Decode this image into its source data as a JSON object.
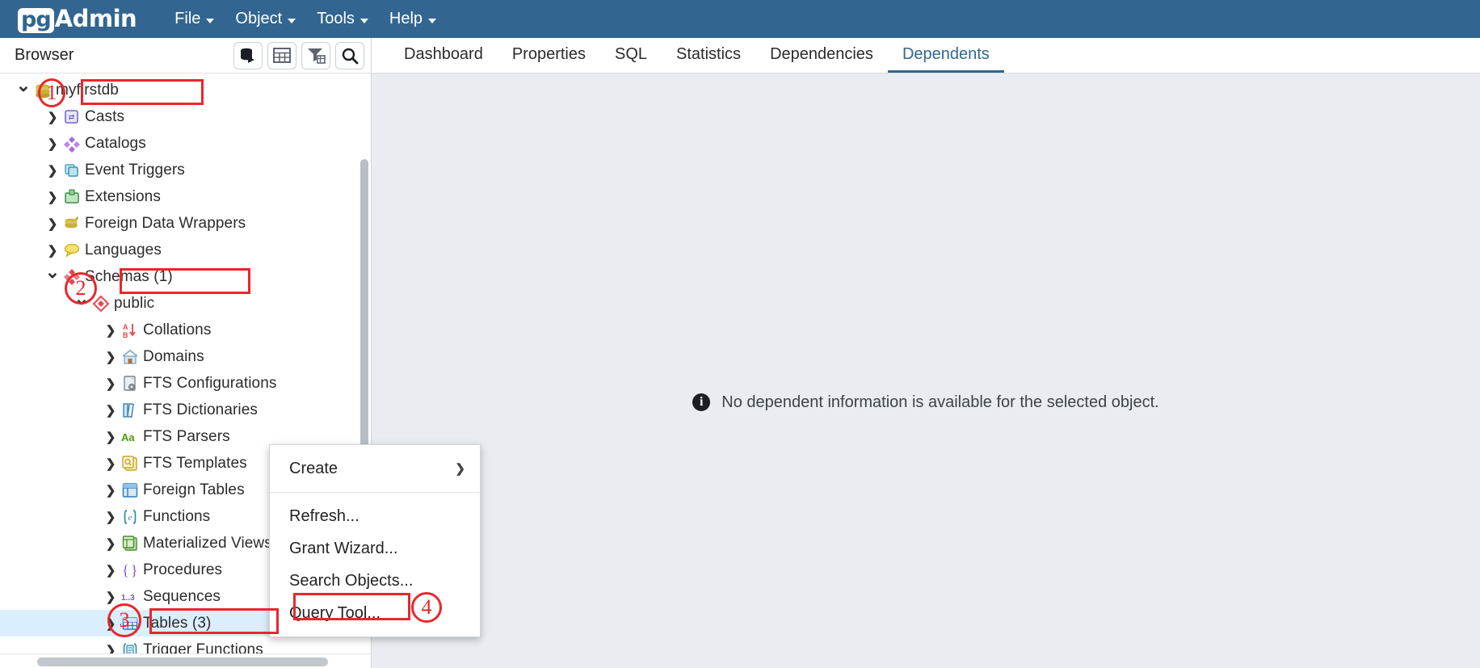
{
  "app": {
    "logo_pg": "pg",
    "logo_admin": "Admin",
    "menus": [
      {
        "label": "File",
        "icon": "chevron-down-icon"
      },
      {
        "label": "Object",
        "icon": "chevron-down-icon"
      },
      {
        "label": "Tools",
        "icon": "chevron-down-icon"
      },
      {
        "label": "Help",
        "icon": "chevron-down-icon"
      }
    ]
  },
  "browser": {
    "title": "Browser",
    "tools": [
      {
        "name": "object-explorer-icon",
        "title": "Object Explorer"
      },
      {
        "name": "grid-view-icon",
        "title": "Grid"
      },
      {
        "name": "filter-icon",
        "title": "Filter"
      },
      {
        "name": "search-icon",
        "title": "Search"
      }
    ],
    "tree": [
      {
        "label": "myfirstdb",
        "icon": "database-icon",
        "indent": 0,
        "state": "open",
        "selected": false,
        "boxed": true
      },
      {
        "label": "Casts",
        "icon": "casts-icon",
        "indent": 1,
        "state": "closed",
        "selected": false,
        "boxed": false
      },
      {
        "label": "Catalogs",
        "icon": "catalogs-icon",
        "indent": 1,
        "state": "closed",
        "selected": false,
        "boxed": false
      },
      {
        "label": "Event Triggers",
        "icon": "event-triggers-icon",
        "indent": 1,
        "state": "closed",
        "selected": false,
        "boxed": false
      },
      {
        "label": "Extensions",
        "icon": "extensions-icon",
        "indent": 1,
        "state": "closed",
        "selected": false,
        "boxed": false
      },
      {
        "label": "Foreign Data Wrappers",
        "icon": "foreign-data-wrappers-icon",
        "indent": 1,
        "state": "closed",
        "selected": false,
        "boxed": false
      },
      {
        "label": "Languages",
        "icon": "languages-icon",
        "indent": 1,
        "state": "closed",
        "selected": false,
        "boxed": false
      },
      {
        "label": "Schemas (1)",
        "icon": "schemas-icon",
        "indent": 1,
        "state": "open",
        "selected": false,
        "boxed": true
      },
      {
        "label": "public",
        "icon": "schema-icon",
        "indent": 2,
        "state": "open",
        "selected": false,
        "boxed": false
      },
      {
        "label": "Collations",
        "icon": "collations-icon",
        "indent": 3,
        "state": "closed",
        "selected": false,
        "boxed": false
      },
      {
        "label": "Domains",
        "icon": "domains-icon",
        "indent": 3,
        "state": "closed",
        "selected": false,
        "boxed": false
      },
      {
        "label": "FTS Configurations",
        "icon": "fts-configurations-icon",
        "indent": 3,
        "state": "closed",
        "selected": false,
        "boxed": false
      },
      {
        "label": "FTS Dictionaries",
        "icon": "fts-dictionaries-icon",
        "indent": 3,
        "state": "closed",
        "selected": false,
        "boxed": false
      },
      {
        "label": "FTS Parsers",
        "icon": "fts-parsers-icon",
        "indent": 3,
        "state": "closed",
        "selected": false,
        "boxed": false
      },
      {
        "label": "FTS Templates",
        "icon": "fts-templates-icon",
        "indent": 3,
        "state": "closed",
        "selected": false,
        "boxed": false
      },
      {
        "label": "Foreign Tables",
        "icon": "foreign-tables-icon",
        "indent": 3,
        "state": "closed",
        "selected": false,
        "boxed": false
      },
      {
        "label": "Functions",
        "icon": "functions-icon",
        "indent": 3,
        "state": "closed",
        "selected": false,
        "boxed": false
      },
      {
        "label": "Materialized Views",
        "icon": "materialized-views-icon",
        "indent": 3,
        "state": "closed",
        "selected": false,
        "boxed": false
      },
      {
        "label": "Procedures",
        "icon": "procedures-icon",
        "indent": 3,
        "state": "closed",
        "selected": false,
        "boxed": false
      },
      {
        "label": "Sequences",
        "icon": "sequences-icon",
        "indent": 3,
        "state": "closed",
        "selected": false,
        "boxed": false
      },
      {
        "label": "Tables (3)",
        "icon": "tables-icon",
        "indent": 3,
        "state": "closed",
        "selected": true,
        "boxed": true
      },
      {
        "label": "Trigger Functions",
        "icon": "trigger-functions-icon",
        "indent": 3,
        "state": "closed",
        "selected": false,
        "boxed": false
      }
    ]
  },
  "content": {
    "tabs": [
      {
        "label": "Dashboard",
        "active": false
      },
      {
        "label": "Properties",
        "active": false
      },
      {
        "label": "SQL",
        "active": false
      },
      {
        "label": "Statistics",
        "active": false
      },
      {
        "label": "Dependencies",
        "active": false
      },
      {
        "label": "Dependents",
        "active": true
      }
    ],
    "empty_message": "No dependent information is available for the selected object.",
    "empty_icon": "info-icon"
  },
  "context_menu": {
    "items": [
      {
        "label": "Create",
        "submenu": true,
        "separator_after": true,
        "boxed": false
      },
      {
        "label": "Refresh...",
        "submenu": false,
        "separator_after": false,
        "boxed": false
      },
      {
        "label": "Grant Wizard...",
        "submenu": false,
        "separator_after": false,
        "boxed": false
      },
      {
        "label": "Search Objects...",
        "submenu": false,
        "separator_after": false,
        "boxed": false
      },
      {
        "label": "Query Tool...",
        "submenu": false,
        "separator_after": false,
        "boxed": true
      }
    ],
    "submenu_arrow": "❯"
  },
  "annotations": {
    "color": "#e8272c",
    "markers": [
      {
        "number": "①",
        "text": "1",
        "target": "myfirstdb"
      },
      {
        "number": "②",
        "text": "2",
        "target": "Schemas (1)"
      },
      {
        "number": "③",
        "text": "3",
        "target": "Tables (3)"
      },
      {
        "number": "④",
        "text": "4",
        "target": "Query Tool..."
      }
    ]
  },
  "colors": {
    "menubar_bg": "#326690",
    "accent": "#326690",
    "selection": "#daeffd",
    "annotation_red": "#e8272c",
    "content_bg": "#e9edf1"
  }
}
